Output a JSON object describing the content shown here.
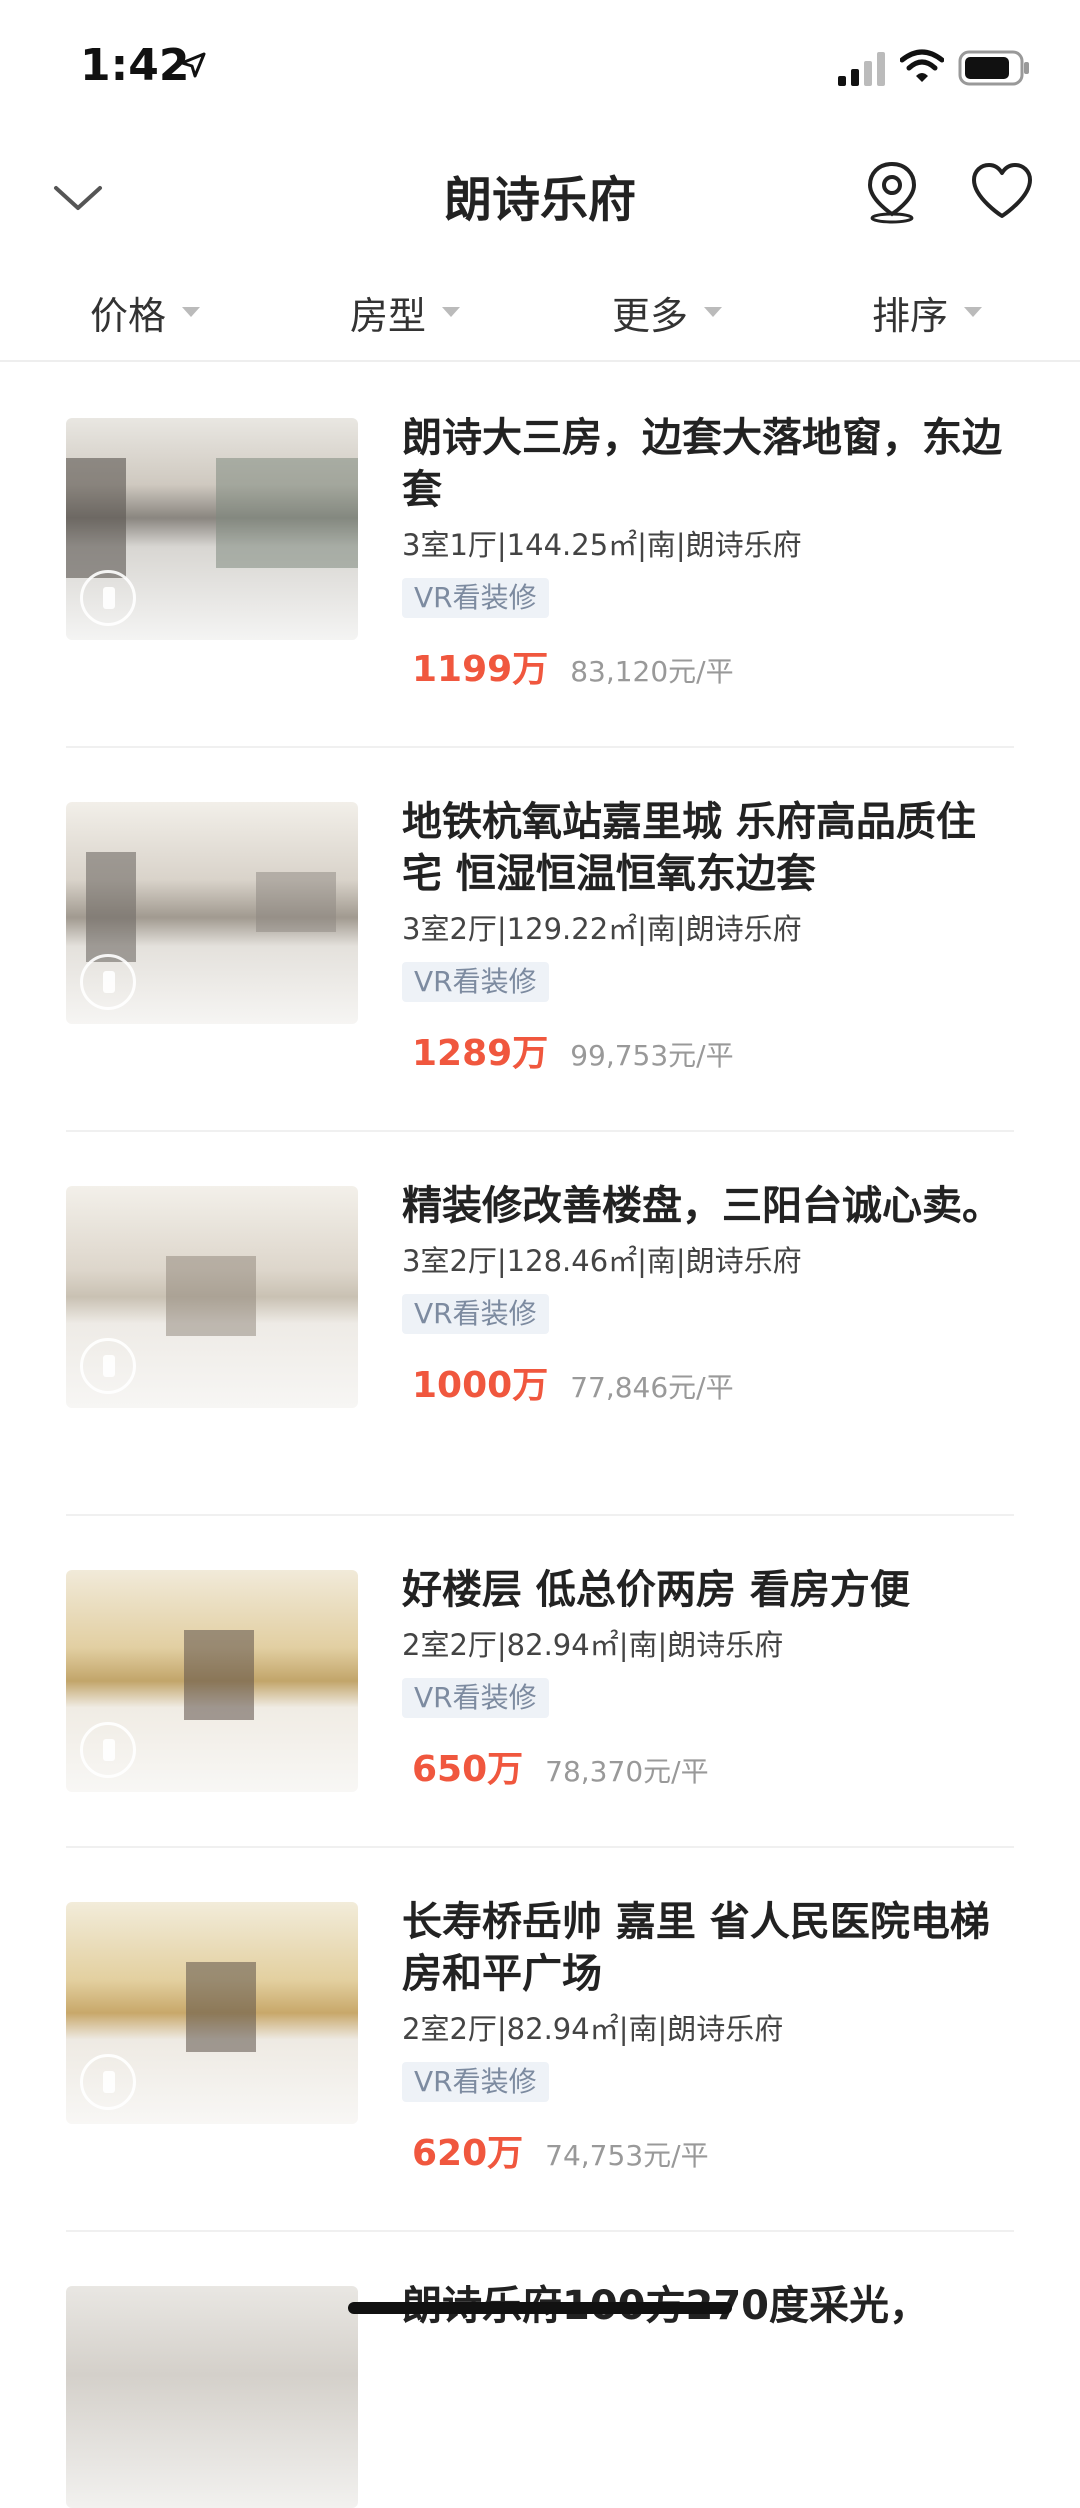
{
  "status": {
    "time": "1:42"
  },
  "header": {
    "title": "朗诗乐府"
  },
  "filters": [
    {
      "label": "价格"
    },
    {
      "label": "房型"
    },
    {
      "label": "更多"
    },
    {
      "label": "排序"
    }
  ],
  "listings": [
    {
      "title": "朗诗大三房，边套大落地窗，东边套",
      "meta": "3室1厅|144.25㎡|南|朗诗乐府",
      "tag": "VR看装修",
      "price": "1199万",
      "unit_price": "83,120元/平"
    },
    {
      "title": "地铁杭氧站嘉里城 乐府高品质住宅 恒湿恒温恒氧东边套",
      "meta": "3室2厅|129.22㎡|南|朗诗乐府",
      "tag": "VR看装修",
      "price": "1289万",
      "unit_price": "99,753元/平"
    },
    {
      "title": "精装修改善楼盘，三阳台诚心卖。",
      "meta": "3室2厅|128.46㎡|南|朗诗乐府",
      "tag": "VR看装修",
      "price": "1000万",
      "unit_price": "77,846元/平"
    },
    {
      "title": "好楼层 低总价两房  看房方便",
      "meta": "2室2厅|82.94㎡|南|朗诗乐府",
      "tag": "VR看装修",
      "price": "650万",
      "unit_price": "78,370元/平"
    },
    {
      "title": "长寿桥岳帅 嘉里 省人民医院电梯房和平广场",
      "meta": "2室2厅|82.94㎡|南|朗诗乐府",
      "tag": "VR看装修",
      "price": "620万",
      "unit_price": "74,753元/平"
    },
    {
      "title": "朗诗乐府100方270度采光，",
      "meta": "",
      "tag": "",
      "price": "",
      "unit_price": ""
    }
  ],
  "colors": {
    "accent": "#f0573e",
    "tag_bg": "#eef2f7",
    "tag_text": "#7d8ba0"
  }
}
